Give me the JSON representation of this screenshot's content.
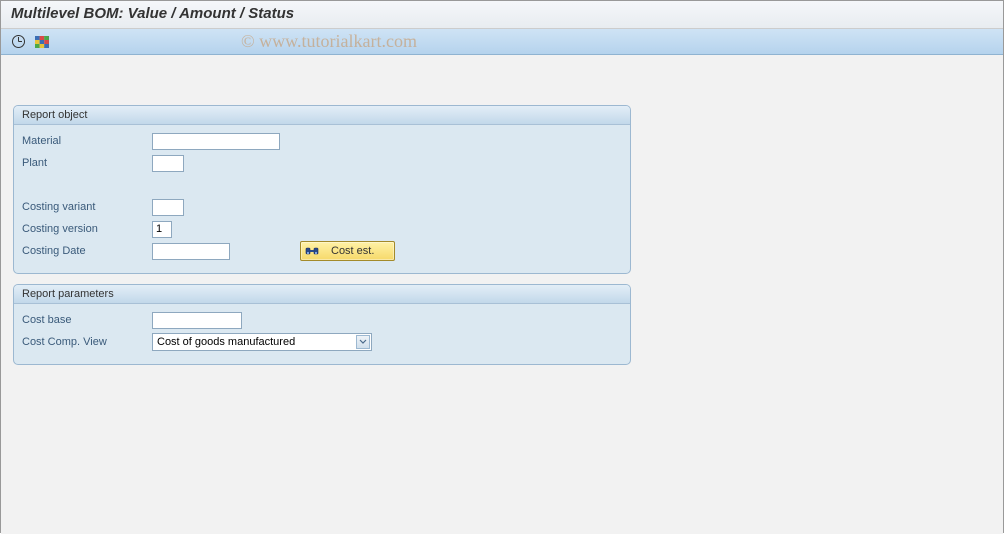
{
  "title": "Multilevel BOM: Value / Amount / Status",
  "watermark": "© www.tutorialkart.com",
  "toolbar": {
    "execute_icon": "execute",
    "grid_icon": "grid"
  },
  "panel1": {
    "title": "Report object",
    "material_label": "Material",
    "material_value": "",
    "plant_label": "Plant",
    "plant_value": "",
    "costing_variant_label": "Costing variant",
    "costing_variant_value": "",
    "costing_version_label": "Costing version",
    "costing_version_value": "1",
    "costing_date_label": "Costing Date",
    "costing_date_value": "",
    "cost_est_button": "Cost est."
  },
  "panel2": {
    "title": "Report parameters",
    "cost_base_label": "Cost base",
    "cost_base_value": "",
    "cost_comp_view_label": "Cost Comp. View",
    "cost_comp_view_value": "Cost of goods manufactured"
  }
}
